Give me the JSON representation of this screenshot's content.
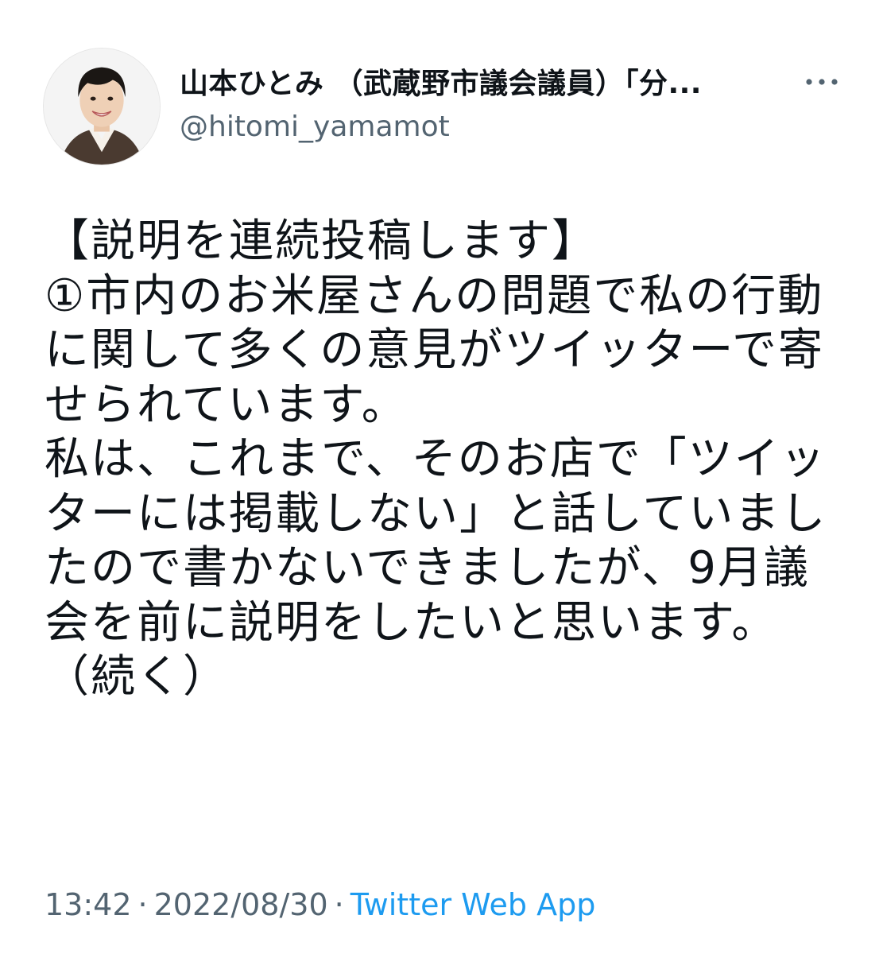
{
  "tweet": {
    "author": {
      "display_name": "山本ひとみ （武蔵野市議会議員）「分...",
      "handle": "@hitomi_yamamot",
      "avatar_icon": "profile-photo"
    },
    "more_icon": "more-options-icon",
    "text": "【説明を連続投稿します】\n①市内のお米屋さんの問題で私の行動に関して多くの意見がツイッターで寄せられています。\n私は、これまで、そのお店で「ツイッターには掲載しない」と話していましたので書かないできましたが、9月議会を前に説明をしたいと思います。\n（続く）",
    "meta": {
      "time": "13:42",
      "separator_1": "·",
      "date": "2022/08/30",
      "separator_2": "·",
      "source": "Twitter Web App"
    }
  },
  "colors": {
    "text_primary": "#0f1419",
    "text_secondary": "#536471",
    "link": "#1d9bf0",
    "background": "#ffffff"
  }
}
